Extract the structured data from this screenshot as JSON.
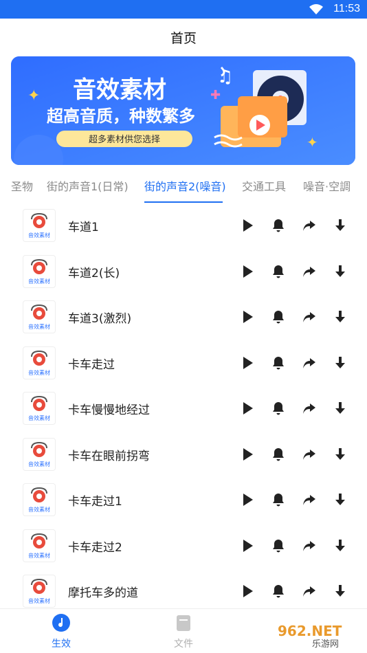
{
  "status": {
    "time": "11:53"
  },
  "header": {
    "title": "首页"
  },
  "banner": {
    "title": "音效素材",
    "subtitle": "超高音质，种数繁多",
    "pill": "超多素材供您选择"
  },
  "tabs": [
    {
      "label": "圣物"
    },
    {
      "label": "街的声音1(日常)"
    },
    {
      "label": "街的声音2(噪音)"
    },
    {
      "label": "交通工具"
    },
    {
      "label": "噪音·空調"
    }
  ],
  "thumb_text": "音效素材",
  "items": [
    {
      "title": "车道1"
    },
    {
      "title": "车道2(长)"
    },
    {
      "title": "车道3(激烈)"
    },
    {
      "title": "卡车走过"
    },
    {
      "title": "卡车慢慢地经过"
    },
    {
      "title": "卡车在眼前拐弯"
    },
    {
      "title": "卡车走过1"
    },
    {
      "title": "卡车走过2"
    },
    {
      "title": "摩托车多的道"
    }
  ],
  "bottom_nav": [
    {
      "label": "生效"
    },
    {
      "label": "文件"
    }
  ],
  "watermark": {
    "top": "962.NET",
    "bottom": "乐游网"
  },
  "colors": {
    "accent": "#1f6ff2",
    "banner": "#2f74ff"
  }
}
